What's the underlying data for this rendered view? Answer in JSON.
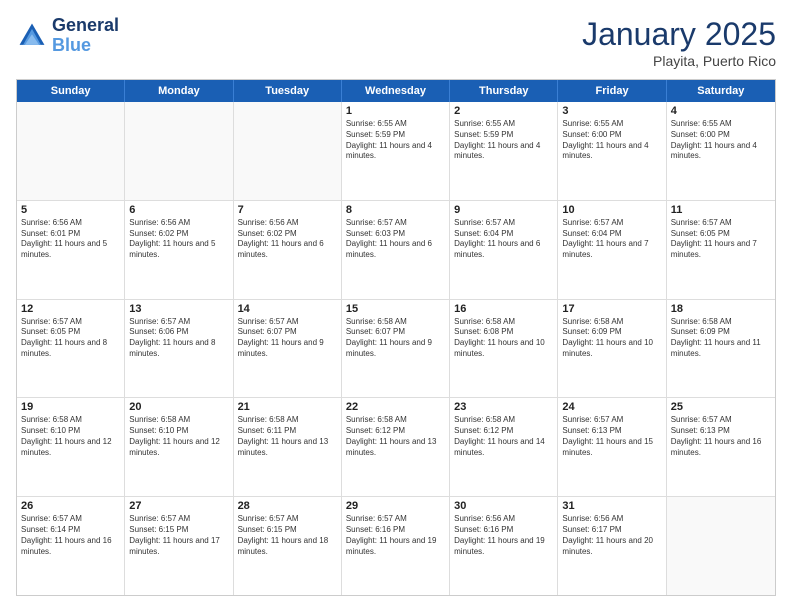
{
  "logo": {
    "line1": "General",
    "line2": "Blue"
  },
  "header": {
    "month": "January 2025",
    "location": "Playita, Puerto Rico"
  },
  "weekdays": [
    "Sunday",
    "Monday",
    "Tuesday",
    "Wednesday",
    "Thursday",
    "Friday",
    "Saturday"
  ],
  "rows": [
    [
      {
        "day": "",
        "sunrise": "",
        "sunset": "",
        "daylight": "",
        "empty": true
      },
      {
        "day": "",
        "sunrise": "",
        "sunset": "",
        "daylight": "",
        "empty": true
      },
      {
        "day": "",
        "sunrise": "",
        "sunset": "",
        "daylight": "",
        "empty": true
      },
      {
        "day": "1",
        "sunrise": "Sunrise: 6:55 AM",
        "sunset": "Sunset: 5:59 PM",
        "daylight": "Daylight: 11 hours and 4 minutes."
      },
      {
        "day": "2",
        "sunrise": "Sunrise: 6:55 AM",
        "sunset": "Sunset: 5:59 PM",
        "daylight": "Daylight: 11 hours and 4 minutes."
      },
      {
        "day": "3",
        "sunrise": "Sunrise: 6:55 AM",
        "sunset": "Sunset: 6:00 PM",
        "daylight": "Daylight: 11 hours and 4 minutes."
      },
      {
        "day": "4",
        "sunrise": "Sunrise: 6:55 AM",
        "sunset": "Sunset: 6:00 PM",
        "daylight": "Daylight: 11 hours and 4 minutes."
      }
    ],
    [
      {
        "day": "5",
        "sunrise": "Sunrise: 6:56 AM",
        "sunset": "Sunset: 6:01 PM",
        "daylight": "Daylight: 11 hours and 5 minutes."
      },
      {
        "day": "6",
        "sunrise": "Sunrise: 6:56 AM",
        "sunset": "Sunset: 6:02 PM",
        "daylight": "Daylight: 11 hours and 5 minutes."
      },
      {
        "day": "7",
        "sunrise": "Sunrise: 6:56 AM",
        "sunset": "Sunset: 6:02 PM",
        "daylight": "Daylight: 11 hours and 6 minutes."
      },
      {
        "day": "8",
        "sunrise": "Sunrise: 6:57 AM",
        "sunset": "Sunset: 6:03 PM",
        "daylight": "Daylight: 11 hours and 6 minutes."
      },
      {
        "day": "9",
        "sunrise": "Sunrise: 6:57 AM",
        "sunset": "Sunset: 6:04 PM",
        "daylight": "Daylight: 11 hours and 6 minutes."
      },
      {
        "day": "10",
        "sunrise": "Sunrise: 6:57 AM",
        "sunset": "Sunset: 6:04 PM",
        "daylight": "Daylight: 11 hours and 7 minutes."
      },
      {
        "day": "11",
        "sunrise": "Sunrise: 6:57 AM",
        "sunset": "Sunset: 6:05 PM",
        "daylight": "Daylight: 11 hours and 7 minutes."
      }
    ],
    [
      {
        "day": "12",
        "sunrise": "Sunrise: 6:57 AM",
        "sunset": "Sunset: 6:05 PM",
        "daylight": "Daylight: 11 hours and 8 minutes."
      },
      {
        "day": "13",
        "sunrise": "Sunrise: 6:57 AM",
        "sunset": "Sunset: 6:06 PM",
        "daylight": "Daylight: 11 hours and 8 minutes."
      },
      {
        "day": "14",
        "sunrise": "Sunrise: 6:57 AM",
        "sunset": "Sunset: 6:07 PM",
        "daylight": "Daylight: 11 hours and 9 minutes."
      },
      {
        "day": "15",
        "sunrise": "Sunrise: 6:58 AM",
        "sunset": "Sunset: 6:07 PM",
        "daylight": "Daylight: 11 hours and 9 minutes."
      },
      {
        "day": "16",
        "sunrise": "Sunrise: 6:58 AM",
        "sunset": "Sunset: 6:08 PM",
        "daylight": "Daylight: 11 hours and 10 minutes."
      },
      {
        "day": "17",
        "sunrise": "Sunrise: 6:58 AM",
        "sunset": "Sunset: 6:09 PM",
        "daylight": "Daylight: 11 hours and 10 minutes."
      },
      {
        "day": "18",
        "sunrise": "Sunrise: 6:58 AM",
        "sunset": "Sunset: 6:09 PM",
        "daylight": "Daylight: 11 hours and 11 minutes."
      }
    ],
    [
      {
        "day": "19",
        "sunrise": "Sunrise: 6:58 AM",
        "sunset": "Sunset: 6:10 PM",
        "daylight": "Daylight: 11 hours and 12 minutes."
      },
      {
        "day": "20",
        "sunrise": "Sunrise: 6:58 AM",
        "sunset": "Sunset: 6:10 PM",
        "daylight": "Daylight: 11 hours and 12 minutes."
      },
      {
        "day": "21",
        "sunrise": "Sunrise: 6:58 AM",
        "sunset": "Sunset: 6:11 PM",
        "daylight": "Daylight: 11 hours and 13 minutes."
      },
      {
        "day": "22",
        "sunrise": "Sunrise: 6:58 AM",
        "sunset": "Sunset: 6:12 PM",
        "daylight": "Daylight: 11 hours and 13 minutes."
      },
      {
        "day": "23",
        "sunrise": "Sunrise: 6:58 AM",
        "sunset": "Sunset: 6:12 PM",
        "daylight": "Daylight: 11 hours and 14 minutes."
      },
      {
        "day": "24",
        "sunrise": "Sunrise: 6:57 AM",
        "sunset": "Sunset: 6:13 PM",
        "daylight": "Daylight: 11 hours and 15 minutes."
      },
      {
        "day": "25",
        "sunrise": "Sunrise: 6:57 AM",
        "sunset": "Sunset: 6:13 PM",
        "daylight": "Daylight: 11 hours and 16 minutes."
      }
    ],
    [
      {
        "day": "26",
        "sunrise": "Sunrise: 6:57 AM",
        "sunset": "Sunset: 6:14 PM",
        "daylight": "Daylight: 11 hours and 16 minutes."
      },
      {
        "day": "27",
        "sunrise": "Sunrise: 6:57 AM",
        "sunset": "Sunset: 6:15 PM",
        "daylight": "Daylight: 11 hours and 17 minutes."
      },
      {
        "day": "28",
        "sunrise": "Sunrise: 6:57 AM",
        "sunset": "Sunset: 6:15 PM",
        "daylight": "Daylight: 11 hours and 18 minutes."
      },
      {
        "day": "29",
        "sunrise": "Sunrise: 6:57 AM",
        "sunset": "Sunset: 6:16 PM",
        "daylight": "Daylight: 11 hours and 19 minutes."
      },
      {
        "day": "30",
        "sunrise": "Sunrise: 6:56 AM",
        "sunset": "Sunset: 6:16 PM",
        "daylight": "Daylight: 11 hours and 19 minutes."
      },
      {
        "day": "31",
        "sunrise": "Sunrise: 6:56 AM",
        "sunset": "Sunset: 6:17 PM",
        "daylight": "Daylight: 11 hours and 20 minutes."
      },
      {
        "day": "",
        "sunrise": "",
        "sunset": "",
        "daylight": "",
        "empty": true
      }
    ]
  ]
}
